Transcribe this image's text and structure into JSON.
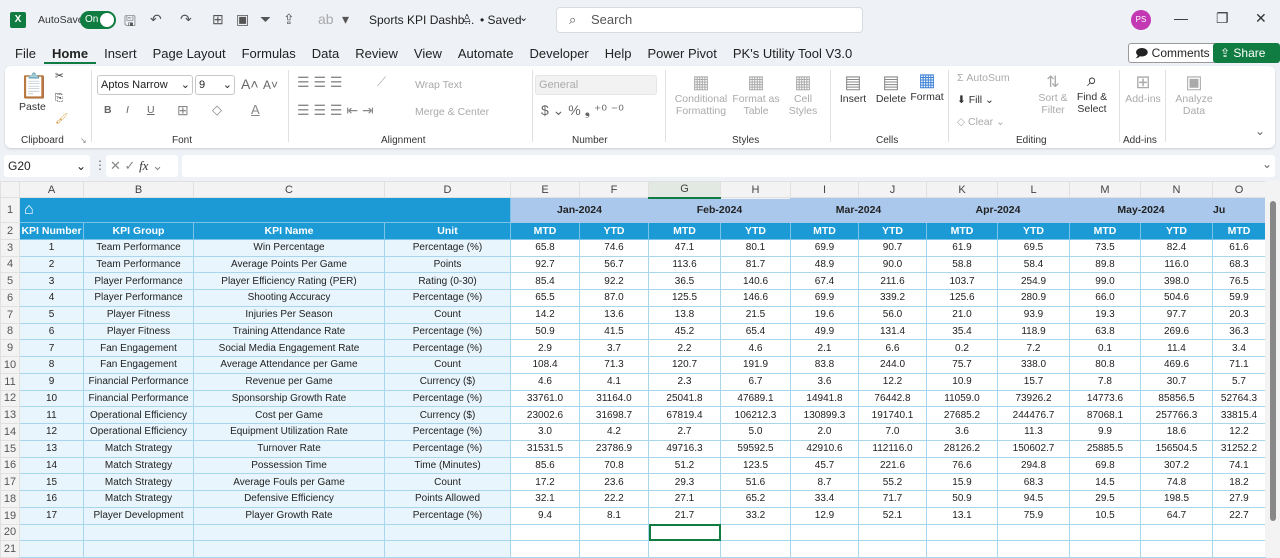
{
  "titlebar": {
    "autosave_label": "AutoSave",
    "autosave_state": "On",
    "file_name": "Sports KPI Dashb...",
    "saved_status": "• Saved",
    "search_placeholder": "Search",
    "user_initials": "PS"
  },
  "menu": {
    "tabs": [
      "File",
      "Home",
      "Insert",
      "Page Layout",
      "Formulas",
      "Data",
      "Review",
      "View",
      "Automate",
      "Developer",
      "Help",
      "Power Pivot",
      "PK's Utility Tool V3.0"
    ],
    "active": "Home",
    "comments_label": "Comments",
    "share_label": "Share"
  },
  "ribbon": {
    "clipboard": {
      "paste": "Paste",
      "label": "Clipboard"
    },
    "font": {
      "name": "Aptos Narrow",
      "size": "9",
      "label": "Font",
      "bold": "B",
      "italic": "I",
      "underline": "U"
    },
    "alignment": {
      "wrap": "Wrap Text",
      "merge": "Merge & Center",
      "label": "Alignment"
    },
    "number": {
      "format": "General",
      "label": "Number"
    },
    "styles": {
      "conditional": "Conditional Formatting",
      "format_table": "Format as Table",
      "cell_styles": "Cell Styles",
      "label": "Styles"
    },
    "cells": {
      "insert": "Insert",
      "delete": "Delete",
      "format": "Format",
      "label": "Cells"
    },
    "editing": {
      "autosum": "AutoSum",
      "fill": "Fill",
      "clear": "Clear",
      "sort": "Sort & Filter",
      "find": "Find & Select",
      "label": "Editing"
    },
    "addins": {
      "addins": "Add-ins",
      "analyze": "Analyze Data",
      "label": "Add-ins"
    }
  },
  "formula_bar": {
    "name_box": "G20",
    "fx": "fx",
    "value": ""
  },
  "sheet": {
    "columns": [
      "A",
      "B",
      "C",
      "D",
      "E",
      "F",
      "G",
      "H",
      "I",
      "J",
      "K",
      "L",
      "M",
      "N",
      "O"
    ],
    "selected_column": "G",
    "selected_cell": "G20",
    "headers": [
      "KPI Number",
      "KPI Group",
      "KPI Name",
      "Unit"
    ],
    "months": [
      "Jan-2024",
      "Feb-2024",
      "Mar-2024",
      "Apr-2024",
      "May-2024",
      "Ju"
    ],
    "sub_headers": [
      "MTD",
      "YTD"
    ],
    "rows": [
      {
        "n": "1",
        "group": "Team Performance",
        "name": "Win Percentage",
        "unit": "Percentage (%)",
        "values": [
          "65.8",
          "74.6",
          "47.1",
          "80.1",
          "69.9",
          "90.7",
          "61.9",
          "69.5",
          "73.5",
          "82.4",
          "61.6"
        ]
      },
      {
        "n": "2",
        "group": "Team Performance",
        "name": "Average Points Per Game",
        "unit": "Points",
        "values": [
          "92.7",
          "56.7",
          "113.6",
          "81.7",
          "48.9",
          "90.0",
          "58.8",
          "58.4",
          "89.8",
          "116.0",
          "68.3"
        ]
      },
      {
        "n": "3",
        "group": "Player Performance",
        "name": "Player Efficiency Rating (PER)",
        "unit": "Rating (0-30)",
        "values": [
          "85.4",
          "92.2",
          "36.5",
          "140.6",
          "67.4",
          "211.6",
          "103.7",
          "254.9",
          "99.0",
          "398.0",
          "76.5"
        ]
      },
      {
        "n": "4",
        "group": "Player Performance",
        "name": "Shooting Accuracy",
        "unit": "Percentage (%)",
        "values": [
          "65.5",
          "87.0",
          "125.5",
          "146.6",
          "69.9",
          "339.2",
          "125.6",
          "280.9",
          "66.0",
          "504.6",
          "59.9"
        ]
      },
      {
        "n": "5",
        "group": "Player Fitness",
        "name": "Injuries Per Season",
        "unit": "Count",
        "values": [
          "14.2",
          "13.6",
          "13.8",
          "21.5",
          "19.6",
          "56.0",
          "21.0",
          "93.9",
          "19.3",
          "97.7",
          "20.3"
        ]
      },
      {
        "n": "6",
        "group": "Player Fitness",
        "name": "Training Attendance Rate",
        "unit": "Percentage (%)",
        "values": [
          "50.9",
          "41.5",
          "45.2",
          "65.4",
          "49.9",
          "131.4",
          "35.4",
          "118.9",
          "63.8",
          "269.6",
          "36.3"
        ]
      },
      {
        "n": "7",
        "group": "Fan Engagement",
        "name": "Social Media Engagement Rate",
        "unit": "Percentage (%)",
        "values": [
          "2.9",
          "3.7",
          "2.2",
          "4.6",
          "2.1",
          "6.6",
          "0.2",
          "7.2",
          "0.1",
          "11.4",
          "3.4"
        ]
      },
      {
        "n": "8",
        "group": "Fan Engagement",
        "name": "Average Attendance per Game",
        "unit": "Count",
        "values": [
          "108.4",
          "71.3",
          "120.7",
          "191.9",
          "83.8",
          "244.0",
          "75.7",
          "338.0",
          "80.8",
          "469.6",
          "71.1"
        ]
      },
      {
        "n": "9",
        "group": "Financial Performance",
        "name": "Revenue per Game",
        "unit": "Currency ($)",
        "values": [
          "4.6",
          "4.1",
          "2.3",
          "6.7",
          "3.6",
          "12.2",
          "10.9",
          "15.7",
          "7.8",
          "30.7",
          "5.7"
        ]
      },
      {
        "n": "10",
        "group": "Financial Performance",
        "name": "Sponsorship Growth Rate",
        "unit": "Percentage (%)",
        "values": [
          "33761.0",
          "31164.0",
          "25041.8",
          "47689.1",
          "14941.8",
          "76442.8",
          "11059.0",
          "73926.2",
          "14773.6",
          "85856.5",
          "52764.3"
        ]
      },
      {
        "n": "11",
        "group": "Operational Efficiency",
        "name": "Cost per Game",
        "unit": "Currency ($)",
        "values": [
          "23002.6",
          "31698.7",
          "67819.4",
          "106212.3",
          "130899.3",
          "191740.1",
          "27685.2",
          "244476.7",
          "87068.1",
          "257766.3",
          "33815.4"
        ]
      },
      {
        "n": "12",
        "group": "Operational Efficiency",
        "name": "Equipment Utilization Rate",
        "unit": "Percentage (%)",
        "values": [
          "3.0",
          "4.2",
          "2.7",
          "5.0",
          "2.0",
          "7.0",
          "3.6",
          "11.3",
          "9.9",
          "18.6",
          "12.2"
        ]
      },
      {
        "n": "13",
        "group": "Match Strategy",
        "name": "Turnover Rate",
        "unit": "Percentage (%)",
        "values": [
          "31531.5",
          "23786.9",
          "49716.3",
          "59592.5",
          "42910.6",
          "112116.0",
          "28126.2",
          "150602.7",
          "25885.5",
          "156504.5",
          "31252.2"
        ]
      },
      {
        "n": "14",
        "group": "Match Strategy",
        "name": "Possession Time",
        "unit": "Time (Minutes)",
        "values": [
          "85.6",
          "70.8",
          "51.2",
          "123.5",
          "45.7",
          "221.6",
          "76.6",
          "294.8",
          "69.8",
          "307.2",
          "74.1"
        ]
      },
      {
        "n": "15",
        "group": "Match Strategy",
        "name": "Average Fouls per Game",
        "unit": "Count",
        "values": [
          "17.2",
          "23.6",
          "29.3",
          "51.6",
          "8.7",
          "55.2",
          "15.9",
          "68.3",
          "14.5",
          "74.8",
          "18.2"
        ]
      },
      {
        "n": "16",
        "group": "Match Strategy",
        "name": "Defensive Efficiency",
        "unit": "Points Allowed",
        "values": [
          "32.1",
          "22.2",
          "27.1",
          "65.2",
          "33.4",
          "71.7",
          "50.9",
          "94.5",
          "29.5",
          "198.5",
          "27.9"
        ]
      },
      {
        "n": "17",
        "group": "Player Development",
        "name": "Player Growth Rate",
        "unit": "Percentage (%)",
        "values": [
          "9.4",
          "8.1",
          "21.7",
          "33.2",
          "12.9",
          "52.1",
          "13.1",
          "75.9",
          "10.5",
          "64.7",
          "22.7"
        ]
      }
    ],
    "row_numbers": [
      "1",
      "2",
      "3",
      "4",
      "5",
      "6",
      "7",
      "8",
      "9",
      "10",
      "11",
      "12",
      "13",
      "14",
      "15",
      "16",
      "17",
      "18",
      "19",
      "20",
      "21"
    ]
  },
  "colors": {
    "header_blue": "#1b9ad6",
    "month_header": "#a9c8ec",
    "label_cell": "#e9f5fc",
    "excel_green": "#107c41"
  }
}
